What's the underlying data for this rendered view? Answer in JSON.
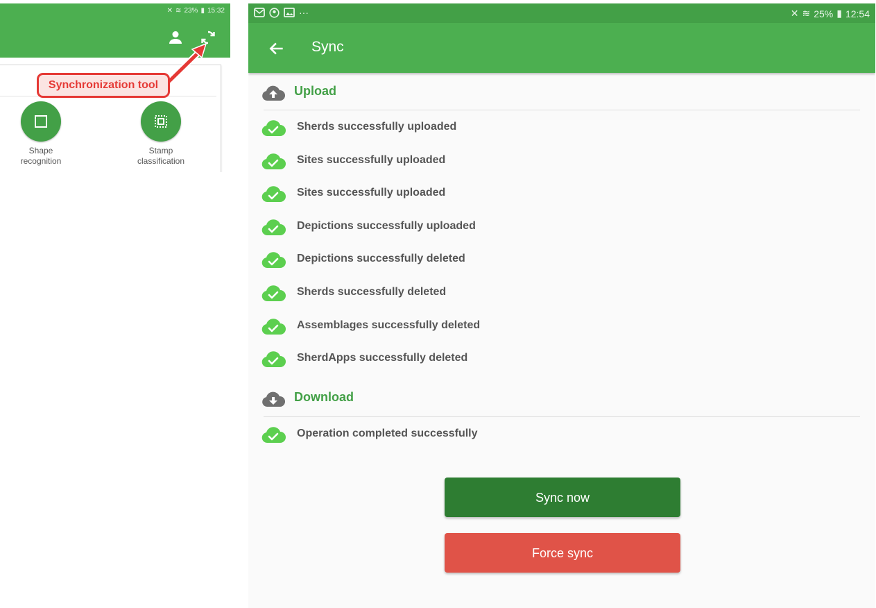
{
  "left": {
    "status_bar": {
      "battery": "23%",
      "time": "15:32"
    },
    "callout": "Synchronization tool",
    "tools": [
      {
        "label": "Shape\nrecognition"
      },
      {
        "label": "Stamp\nclassification"
      }
    ],
    "icons": [
      "person-icon",
      "sync-icon",
      "shape-icon",
      "stamp-icon"
    ]
  },
  "right": {
    "status_bar": {
      "battery": "25%",
      "time": "12:54",
      "overflow": "···"
    },
    "title": "Sync",
    "upload": {
      "title": "Upload",
      "items": [
        "Sherds successfully uploaded",
        "Sites successfully uploaded",
        "Sites successfully uploaded",
        "Depictions successfully uploaded",
        "Depictions successfully deleted",
        "Sherds successfully deleted",
        "Assemblages successfully deleted",
        "SherdApps successfully deleted"
      ]
    },
    "download": {
      "title": "Download",
      "items": [
        "Operation completed successfully"
      ]
    },
    "buttons": {
      "sync_now": "Sync now",
      "force_sync": "Force sync"
    },
    "colors": {
      "appbar": "#4caf50",
      "accent": "#43a047",
      "sync_button": "#2e7d32",
      "force_button": "#e05348",
      "check": "#5ccf4f"
    }
  }
}
